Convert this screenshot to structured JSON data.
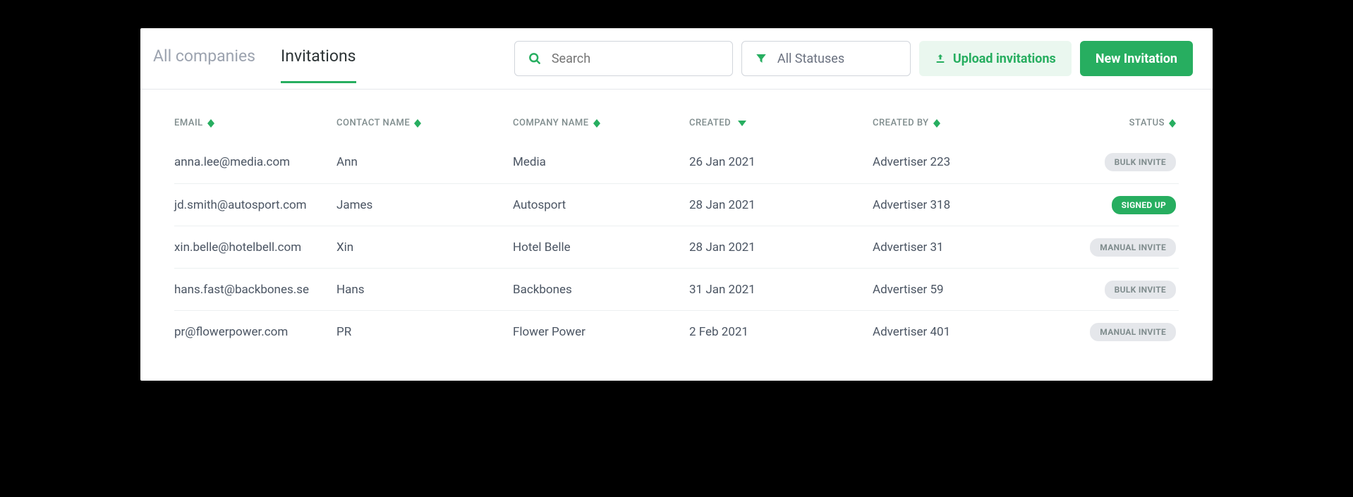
{
  "tabs": {
    "all_companies": "All companies",
    "invitations": "Invitations"
  },
  "search": {
    "placeholder": "Search"
  },
  "filter": {
    "label": "All Statuses"
  },
  "buttons": {
    "upload": "Upload invitations",
    "new": "New Invitation"
  },
  "columns": {
    "email": "EMAIL",
    "contact_name": "CONTACT NAME",
    "company_name": "COMPANY NAME",
    "created": "CREATED",
    "created_by": "CREATED BY",
    "status": "STATUS"
  },
  "status_labels": {
    "bulk_invite": "BULK INVITE",
    "signed_up": "SIGNED UP",
    "manual_invite": "MANUAL INVITE"
  },
  "rows": [
    {
      "email": "anna.lee@media.com",
      "contact_name": "Ann",
      "company_name": "Media",
      "created": "26 Jan 2021",
      "created_by": "Advertiser 223",
      "status": "bulk_invite"
    },
    {
      "email": "jd.smith@autosport.com",
      "contact_name": "James",
      "company_name": "Autosport",
      "created": "28 Jan 2021",
      "created_by": "Advertiser 318",
      "status": "signed_up"
    },
    {
      "email": "xin.belle@hotelbell.com",
      "contact_name": "Xin",
      "company_name": "Hotel Belle",
      "created": "28 Jan 2021",
      "created_by": "Advertiser 31",
      "status": "manual_invite"
    },
    {
      "email": "hans.fast@backbones.se",
      "contact_name": "Hans",
      "company_name": "Backbones",
      "created": "31 Jan 2021",
      "created_by": "Advertiser 59",
      "status": "bulk_invite"
    },
    {
      "email": "pr@flowerpower.com",
      "contact_name": "PR",
      "company_name": "Flower Power",
      "created": "2 Feb 2021",
      "created_by": "Advertiser 401",
      "status": "manual_invite"
    }
  ],
  "colors": {
    "accent": "#27ae60",
    "muted": "#9ca3af",
    "badge_grey_bg": "#e5e7eb",
    "badge_grey_fg": "#7f8c8d"
  }
}
